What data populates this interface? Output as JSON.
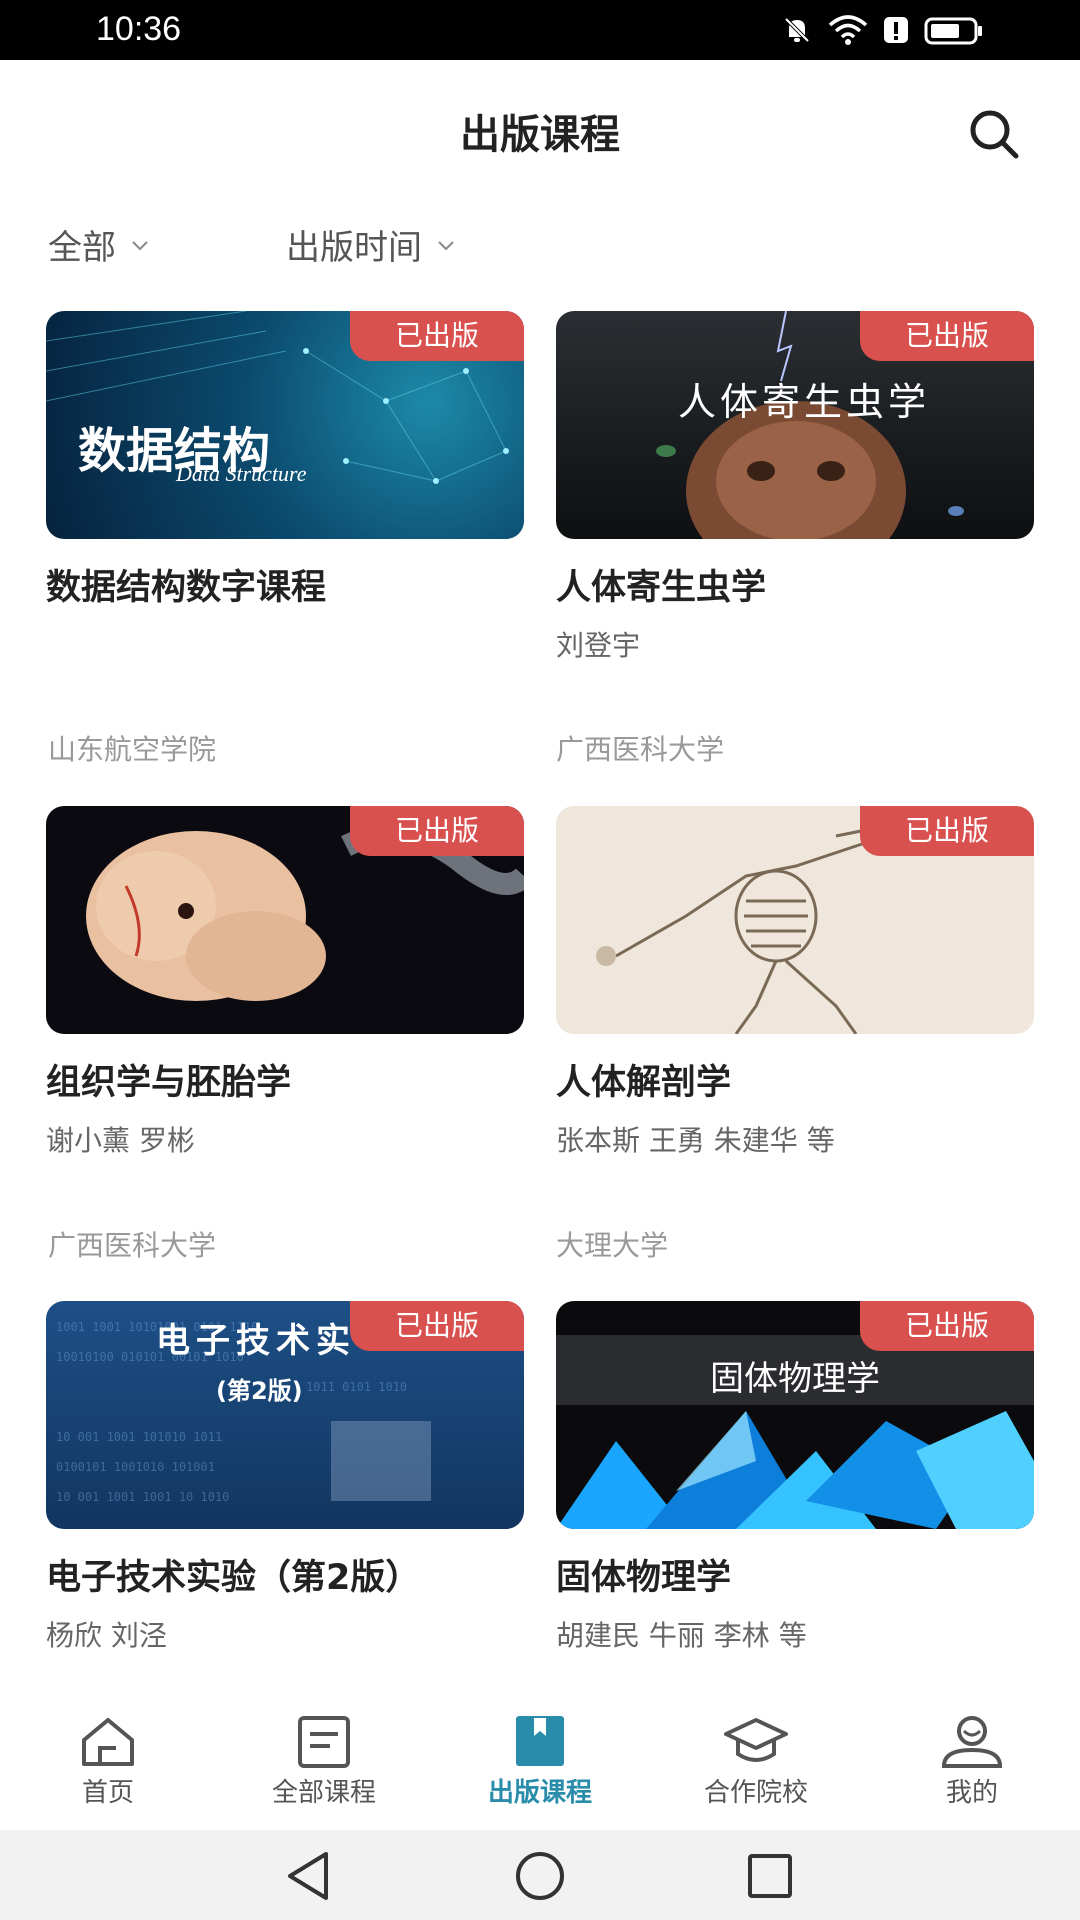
{
  "status_bar": {
    "time": "10:36"
  },
  "header": {
    "title": "出版课程"
  },
  "filters": {
    "category": "全部",
    "sort": "出版时间"
  },
  "badge_label": "已出版",
  "courses": [
    {
      "title": "数据结构数字课程",
      "authors": "",
      "thumb_text": "数据结构",
      "thumb_subtext": "Data Structure"
    },
    {
      "title": "人体寄生虫学",
      "authors": "刘登宇",
      "thumb_text": "人体寄生虫学"
    },
    {
      "title": "组织学与胚胎学",
      "authors": "谢小薰 罗彬"
    },
    {
      "title": "人体解剖学",
      "authors": "张本斯 王勇 朱建华 等"
    },
    {
      "title": "电子技术实验（第2版）",
      "authors": "杨欣 刘泾",
      "thumb_text": "电子技术实",
      "thumb_subtext": "(第2版)"
    },
    {
      "title": "固体物理学",
      "authors": "胡建民 牛丽 李林 等",
      "thumb_text": "固体物理学"
    }
  ],
  "schools": [
    "山东航空学院",
    "广西医科大学",
    "广西医科大学",
    "大理大学"
  ],
  "bottom_nav": [
    {
      "label": "首页",
      "icon": "home-icon"
    },
    {
      "label": "全部课程",
      "icon": "course-list-icon"
    },
    {
      "label": "出版课程",
      "icon": "bookmark-icon",
      "active": true
    },
    {
      "label": "合作院校",
      "icon": "graduation-cap-icon"
    },
    {
      "label": "我的",
      "icon": "user-icon"
    }
  ],
  "colors": {
    "accent": "#2a8cab",
    "badge": "#d9514e"
  }
}
